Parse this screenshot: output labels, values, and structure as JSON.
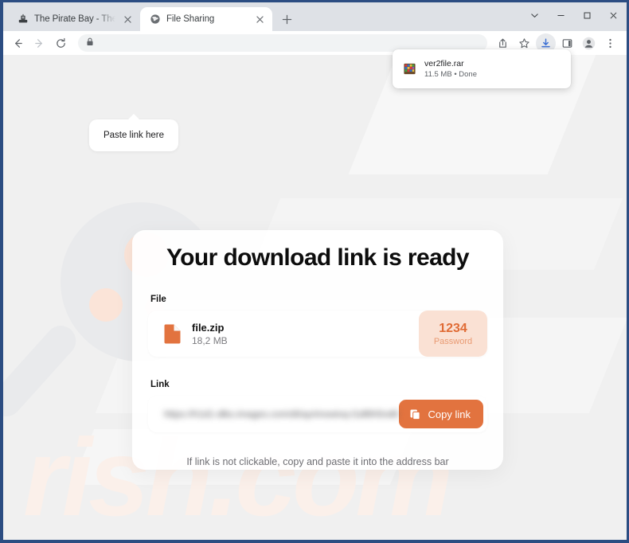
{
  "browser": {
    "tabs": [
      {
        "title": "The Pirate Bay - The galaxy's mo",
        "favicon": "pirate-ship-icon",
        "active": false
      },
      {
        "title": "File Sharing",
        "favicon": "globe-icon",
        "active": true
      }
    ],
    "new_tab_label": "+",
    "window_controls": {
      "minimize_all": "chevron-down-icon",
      "minimize": "minimize-icon",
      "maximize": "maximize-icon",
      "close": "close-icon"
    },
    "toolbar": {
      "back": "back-arrow-icon",
      "forward": "forward-arrow-icon",
      "reload": "reload-icon",
      "omnibox_lock": "lock-icon",
      "omnibox_value": "",
      "omnibox_placeholder": "",
      "share": "share-icon",
      "bookmark": "star-icon",
      "downloads": "download-icon",
      "side_panel": "side-panel-icon",
      "profile": "profile-avatar-icon",
      "menu": "three-dot-menu-icon"
    },
    "download_bubble": {
      "filename": "ver2file.rar",
      "meta": "11.5 MB • Done",
      "icon": "rar-archive-icon"
    }
  },
  "page": {
    "tooltip": "Paste link here",
    "watermark": "rish.com",
    "card": {
      "title": "Your download link is ready",
      "file_label": "File",
      "file": {
        "name": "file.zip",
        "size": "18,2 MB",
        "icon": "zip-file-icon"
      },
      "password": {
        "value": "1234",
        "label": "Password"
      },
      "link_label": "Link",
      "link_value": "https://h1d1-dlks.images.com/dl/ayrimxwivq-l1dl6h5nd6k19l13",
      "copy_button": {
        "label": "Copy link",
        "icon": "copy-icon"
      },
      "footer_note": "If link is not clickable, copy and paste it into the address bar"
    }
  },
  "colors": {
    "accent_orange": "#e2733f",
    "password_bg": "#fae1d4",
    "password_text": "#e06b35",
    "page_bg": "#f0f0f0",
    "window_border": "#2c4d82"
  }
}
